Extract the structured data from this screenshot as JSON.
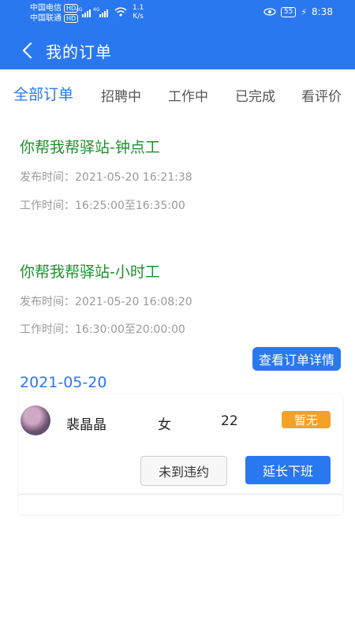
{
  "status_bar": {
    "carrier1": "中国电信",
    "carrier2": "中国联通",
    "hd": "HD",
    "net1": "4G",
    "net2": "4G",
    "speed_value": "1.1",
    "speed_unit": "K/s",
    "battery": "55",
    "time": "8:38"
  },
  "header": {
    "title": "我的订单"
  },
  "tabs": [
    {
      "label": "全部订单",
      "active": true
    },
    {
      "label": "招聘中"
    },
    {
      "label": "工作中"
    },
    {
      "label": "已完成"
    },
    {
      "label": "看评价"
    }
  ],
  "orders": [
    {
      "title": "你帮我帮驿站-钟点工",
      "publish_time": "发布时间：2021-05-20 16:21:38",
      "work_time": "工作时间：16:25:00至16:35:00"
    },
    {
      "title": "你帮我帮驿站-小时工",
      "publish_time": "发布时间：2021-05-20 16:08:20",
      "work_time": "工作时间：16:30:00至20:00:00",
      "detail_button": "查看订单详情",
      "date": "2021-05-20",
      "worker": {
        "name": "裴晶晶",
        "gender": "女",
        "age": "22",
        "badge": "暂无",
        "btn_absent": "未到违约",
        "btn_extend": "延长下班"
      }
    }
  ],
  "colors": {
    "primary": "#2a78f0",
    "title_green": "#1f8f2e",
    "badge_orange": "#f4a12a"
  }
}
